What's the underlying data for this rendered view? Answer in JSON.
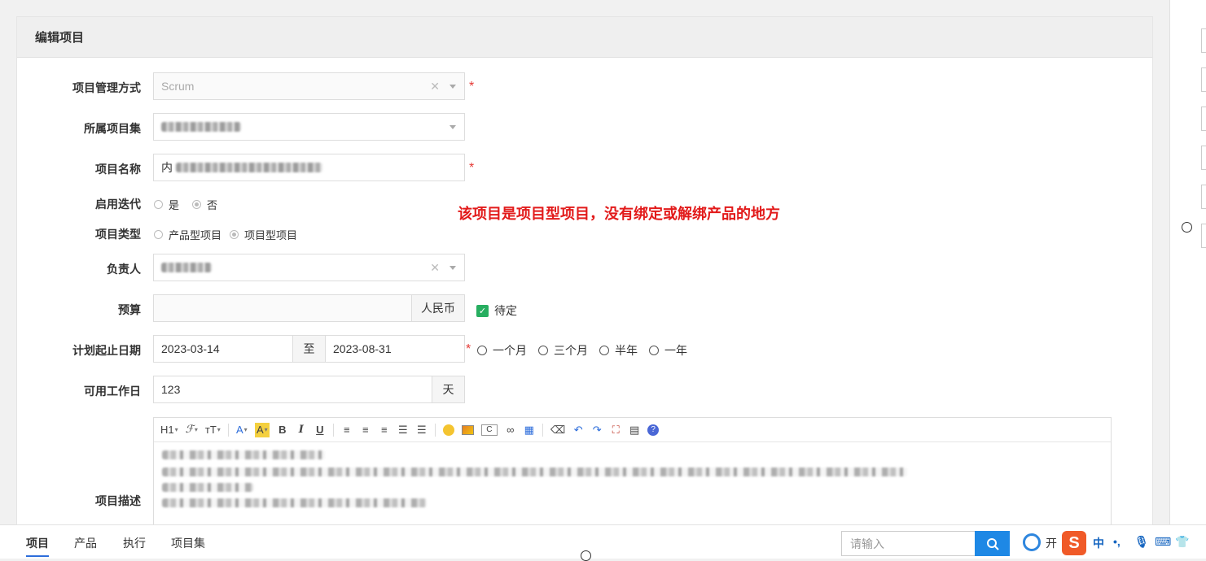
{
  "panel": {
    "title": "编辑项目"
  },
  "form": {
    "mgmt": {
      "label": "项目管理方式",
      "value": "Scrum"
    },
    "program": {
      "label": "所属项目集"
    },
    "name": {
      "label": "项目名称",
      "value_prefix": "内"
    },
    "iteration": {
      "label": "启用迭代",
      "options": [
        "是",
        "否"
      ],
      "selected": "否"
    },
    "type": {
      "label": "项目类型",
      "options": [
        "产品型项目",
        "项目型项目"
      ],
      "selected": "项目型项目"
    },
    "owner": {
      "label": "负责人"
    },
    "budget": {
      "label": "预算",
      "unit": "人民币",
      "pending_label": "待定",
      "pending_checked": true
    },
    "dates": {
      "label": "计划起止日期",
      "start": "2023-03-14",
      "sep": "至",
      "end": "2023-08-31",
      "presets": [
        "一个月",
        "三个月",
        "半年",
        "一年"
      ]
    },
    "workdays": {
      "label": "可用工作日",
      "value": "123",
      "unit": "天"
    },
    "desc": {
      "label": "项目描述"
    }
  },
  "annotation": {
    "text": "该项目是项目型项目，没有绑定或解绑产品的地方",
    "color": "#e21a1a"
  },
  "toolbar": {
    "heading": "H1",
    "font": "ℱ",
    "size": "тT",
    "bold": "B",
    "italic": "I",
    "underline": "U"
  },
  "bottom": {
    "tabs": [
      "项目",
      "产品",
      "执行",
      "项目集"
    ],
    "active_tab": "项目",
    "search_placeholder": "请输入",
    "partial_text": "开",
    "ime": {
      "lang": "中",
      "punct": "•,"
    }
  },
  "colors": {
    "primary": "#1e88e5",
    "required": "#e53935",
    "check": "#27ae60"
  }
}
